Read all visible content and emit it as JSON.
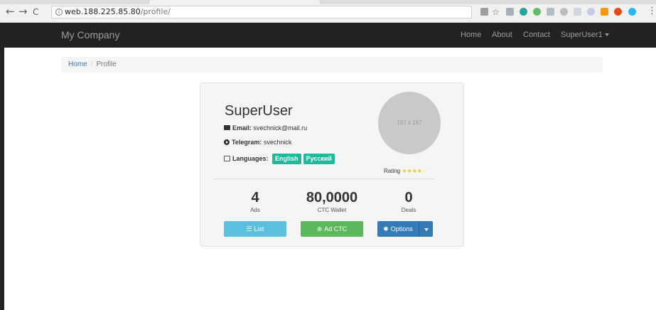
{
  "browser": {
    "back": "←",
    "forward": "→",
    "reload": "C",
    "url_host": "web.188.225.85.80",
    "url_path": "/profile/",
    "bookmark": "☆",
    "menu": "⋮"
  },
  "navbar": {
    "brand": "My Company",
    "links": [
      "Home",
      "About",
      "Contact"
    ],
    "user": "SuperUser1"
  },
  "breadcrumb": {
    "home": "Home",
    "separator": "/",
    "current": "Profile"
  },
  "profile": {
    "name": "SuperUser",
    "email_label": "Email:",
    "email": "svechnick@mail.ru",
    "telegram_label": "Telegram:",
    "telegram": "svechnick",
    "languages_label": "Languages:",
    "languages": [
      "English",
      "Русский"
    ],
    "avatar_placeholder": "167 x 167",
    "rating_label": "Rating",
    "rating_value": 4,
    "rating_max": 5
  },
  "stats": [
    {
      "value": "4",
      "label": "Ads"
    },
    {
      "value": "80,0000",
      "label": "CTC Wallet"
    },
    {
      "value": "0",
      "label": "Deals"
    }
  ],
  "buttons": {
    "list": "List",
    "add_ctc": "Ad CTC",
    "options": "Options"
  },
  "colors": {
    "navbar": "#222222",
    "language_badge": "#1abc9c",
    "btn_info": "#5bc0de",
    "btn_success": "#5cb85c",
    "btn_primary": "#337ab7",
    "star": "#f0c419"
  }
}
